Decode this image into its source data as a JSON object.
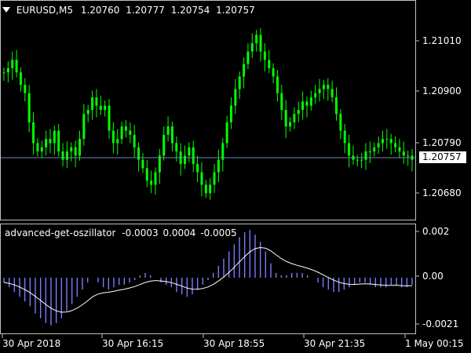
{
  "symbol_label": "EURUSD,M5",
  "ohlc": [
    "1.20760",
    "1.20777",
    "1.20754",
    "1.20757"
  ],
  "price_axis": [
    "1.21010",
    "1.20900",
    "1.20790",
    "1.20680"
  ],
  "current_price": "1.20757",
  "indicator": {
    "name": "advanced-get-oszillator",
    "values": [
      "-0.0003",
      "0.0004",
      "-0.0005"
    ],
    "axis": [
      "0.002",
      "0.00",
      "-0.0021"
    ]
  },
  "time_axis": [
    "30 Apr 2018",
    "30 Apr 16:15",
    "30 Apr 18:55",
    "30 Apr 21:35",
    "1 May 00:15"
  ],
  "colors": {
    "candle": "#00ff00",
    "histogram": "#7b7bff",
    "signal": "#ffffff",
    "grid": "#c0c0c0",
    "price_line": "#7089b0"
  },
  "icon": "sort-down-triangle-icon",
  "chart_data": {
    "type": "line",
    "price_ylim": [
      1.2062,
      1.2114
    ],
    "osc_ylim": [
      -0.0023,
      0.0022
    ],
    "close": [
      1.2097,
      1.2098,
      1.21,
      1.2097,
      1.2094,
      1.2092,
      1.2085,
      1.208,
      1.2078,
      1.2079,
      1.2081,
      1.208,
      1.2083,
      1.2078,
      1.2076,
      1.2078,
      1.2079,
      1.2077,
      1.2081,
      1.2087,
      1.2088,
      1.2091,
      1.2089,
      1.2088,
      1.2089,
      1.2083,
      1.208,
      1.2081,
      1.2084,
      1.2083,
      1.2082,
      1.2079,
      1.2076,
      1.2074,
      1.2071,
      1.207,
      1.2073,
      1.2077,
      1.2082,
      1.2084,
      1.208,
      1.2078,
      1.2075,
      1.2077,
      1.2079,
      1.2075,
      1.2073,
      1.207,
      1.2068,
      1.207,
      1.2073,
      1.2076,
      1.208,
      1.2085,
      1.2089,
      1.2093,
      1.2096,
      1.2099,
      1.2102,
      1.2104,
      1.2106,
      1.2102,
      1.21,
      1.2098,
      1.2096,
      1.2092,
      1.2088,
      1.2084,
      1.2085,
      1.2087,
      1.2088,
      1.209,
      1.2089,
      1.2091,
      1.2092,
      1.2093,
      1.2094,
      1.2093,
      1.2091,
      1.2087,
      1.2083,
      1.208,
      1.2077,
      1.2076,
      1.2076,
      1.2076,
      1.2078,
      1.2078,
      1.2079,
      1.208,
      1.2081,
      1.2081,
      1.208,
      1.2079,
      1.2078,
      1.2077,
      1.2077,
      1.2076
    ],
    "oscillator": [
      -0.0002,
      -0.0004,
      -0.0006,
      -0.0008,
      -0.001,
      -0.0012,
      -0.0015,
      -0.0017,
      -0.0019,
      -0.002,
      -0.0019,
      -0.0017,
      -0.0014,
      -0.0011,
      -0.0008,
      -0.0005,
      -0.0002,
      0.0,
      -0.0002,
      -0.0004,
      -0.0005,
      -0.0004,
      -0.0003,
      -0.0003,
      -0.0002,
      -0.0001,
      0.0001,
      0.0002,
      0.0001,
      0.0,
      -0.0002,
      -0.0003,
      -0.0004,
      -0.0006,
      -0.0007,
      -0.0008,
      -0.0007,
      -0.0005,
      -0.0003,
      -0.0001,
      0.0002,
      0.0005,
      0.0008,
      0.0011,
      0.0014,
      0.0017,
      0.0019,
      0.002,
      0.0018,
      0.0015,
      0.0011,
      0.0006,
      0.0002,
      0.0001,
      0.0001,
      0.0002,
      0.0002,
      0.0002,
      0.0001,
      0.0,
      -0.0002,
      -0.0004,
      -0.0005,
      -0.0006,
      -0.0006,
      -0.0005,
      -0.0004,
      -0.0003,
      -0.0002,
      -0.0002,
      -0.0003,
      -0.0004,
      -0.0004,
      -0.0004,
      -0.0003,
      -0.0003,
      -0.0004,
      -0.0004,
      -0.0003
    ]
  }
}
